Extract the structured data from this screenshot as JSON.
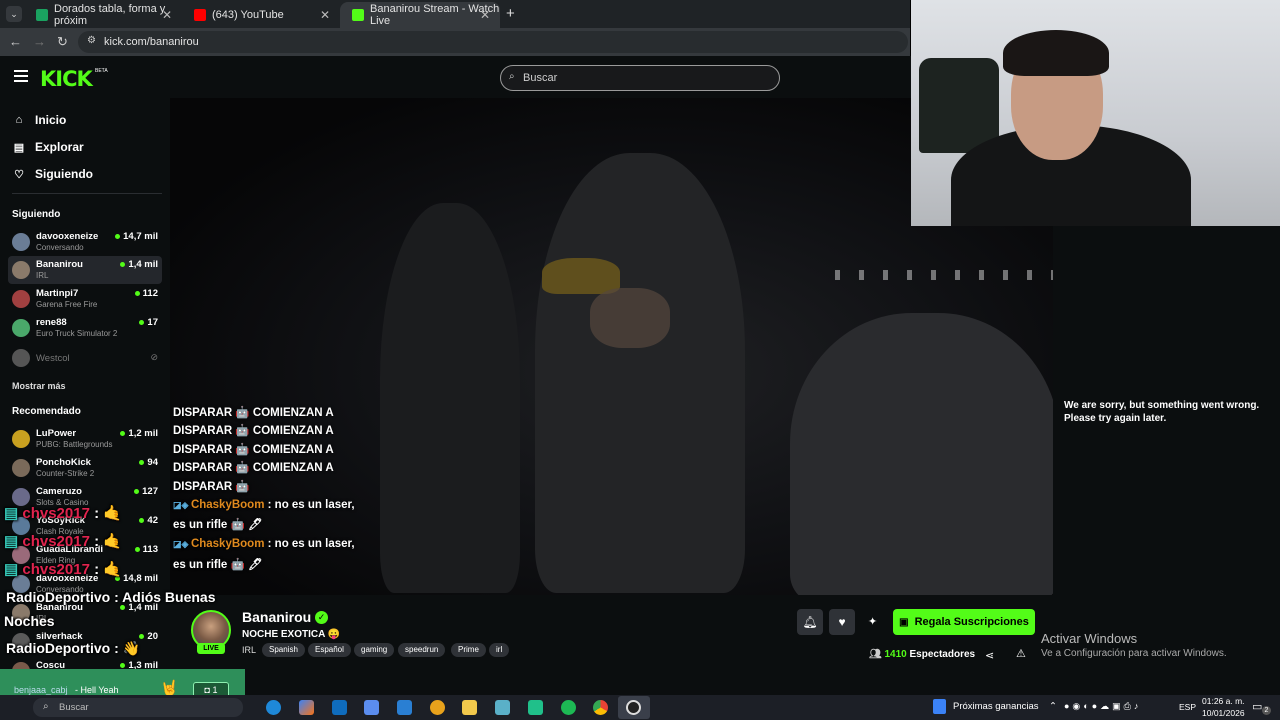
{
  "browser": {
    "tabs": [
      {
        "title": "Dorados tabla, forma y próxim",
        "color": "#1aa260"
      },
      {
        "title": "(643) YouTube",
        "color": "#ff0000"
      },
      {
        "title": "Bananirou Stream - Watch Live",
        "color": "#53fc18"
      }
    ],
    "url": "kick.com/bananirou",
    "new_tab": "+"
  },
  "kick": {
    "logo": "KICK",
    "beta": "BETA",
    "search_placeholder": "Buscar",
    "nav": [
      {
        "label": "Inicio",
        "icon": "home-icon"
      },
      {
        "label": "Explorar",
        "icon": "compass-icon"
      },
      {
        "label": "Siguiendo",
        "icon": "heart-icon"
      }
    ],
    "following_header": "Siguiendo",
    "following": [
      {
        "name": "davooxeneize",
        "category": "Conversando",
        "viewers": "14,7 mil",
        "color": "#6a7d96"
      },
      {
        "name": "Bananirou",
        "category": "IRL",
        "viewers": "1,4 mil",
        "color": "#8a7a6a"
      },
      {
        "name": "Martinpi7",
        "category": "Garena Free Fire",
        "viewers": "112",
        "color": "#a04040"
      },
      {
        "name": "rene88",
        "category": "Euro Truck Simulator 2",
        "viewers": "17",
        "color": "#4aa86a"
      },
      {
        "name": "Westcol",
        "category": "",
        "viewers": "",
        "color": "#555"
      }
    ],
    "show_more": "Mostrar más",
    "recommended_header": "Recomendado",
    "recommended": [
      {
        "name": "LuPower",
        "category": "PUBG: Battlegrounds",
        "viewers": "1,2 mil",
        "color": "#c8a020"
      },
      {
        "name": "PonchoKick",
        "category": "Counter-Strike 2",
        "viewers": "94",
        "color": "#7a6a5a"
      },
      {
        "name": "Cameruzo",
        "category": "Slots & Casino",
        "viewers": "127",
        "color": "#6a6a8a"
      },
      {
        "name": "YoSoyRick",
        "category": "Clash Royale",
        "viewers": "42",
        "color": "#5a7a9a"
      },
      {
        "name": "GuadaLibrandi",
        "category": "Elden Ring",
        "viewers": "113",
        "color": "#9a6a7a"
      },
      {
        "name": "davooxeneize",
        "category": "Conversando",
        "viewers": "14,8 mil",
        "color": "#6a7d96"
      },
      {
        "name": "Bananirou",
        "category": "IRL",
        "viewers": "1,4 mil",
        "color": "#8a7a6a"
      },
      {
        "name": "silverhack",
        "category": "",
        "viewers": "20",
        "color": "#5a5a5a"
      },
      {
        "name": "Coscu",
        "category": "",
        "viewers": "1,3 mil",
        "color": "#7a5a4a"
      }
    ]
  },
  "video_chat": {
    "spam_lines": [
      "DISPARAR 🤖 COMIENZAN A",
      "DISPARAR 🤖 COMIENZAN A",
      "DISPARAR 🤖 COMIENZAN A",
      "DISPARAR 🤖 COMIENZAN A",
      "DISPARAR 🤖"
    ],
    "msg1_user": "ChaskyBoom",
    "msg1_text": ": no es un laser,",
    "msg1_cont": "es un rifle 🤖 🖊",
    "msg2_user": "ChaskyBoom",
    "msg2_text": ": no es un laser,",
    "msg2_cont": "es un rifle 🤖 🖊"
  },
  "error": {
    "line1": "We are sorry, but something went wrong.",
    "line2": "Please try again later."
  },
  "overlay_chat": {
    "user1": "chvs2017",
    "sep": ":",
    "radio_user": "RadioDeportivo",
    "radio_msg1": ": Adiós Buenas",
    "radio_msg1b": "Noches",
    "radio_msg2": ":",
    "radio_emoji": "👋",
    "notif_user": "benjaaa_cabj",
    "notif_msg": "- Hell Yeah",
    "notif_count": "1"
  },
  "stream": {
    "name": "Bananirou",
    "title": "NOCHE EXOTICA 😛",
    "live": "LIVE",
    "category": "IRL",
    "tags": [
      "Spanish",
      "Español",
      "gaming",
      "speedrun",
      "Prime",
      "irl"
    ],
    "subscribe_label": "Regala Suscripciones",
    "viewers_count": "1410",
    "viewers_label": "Espectadores"
  },
  "windows": {
    "activate_title": "Activar Windows",
    "activate_sub": "Ve a Configuración para activar Windows.",
    "search_placeholder": "Buscar",
    "earnings": "Próximas ganancias",
    "lang": "ESP",
    "time": "01:26 a. m.",
    "date": "10/01/2026",
    "notif_count": "2"
  }
}
